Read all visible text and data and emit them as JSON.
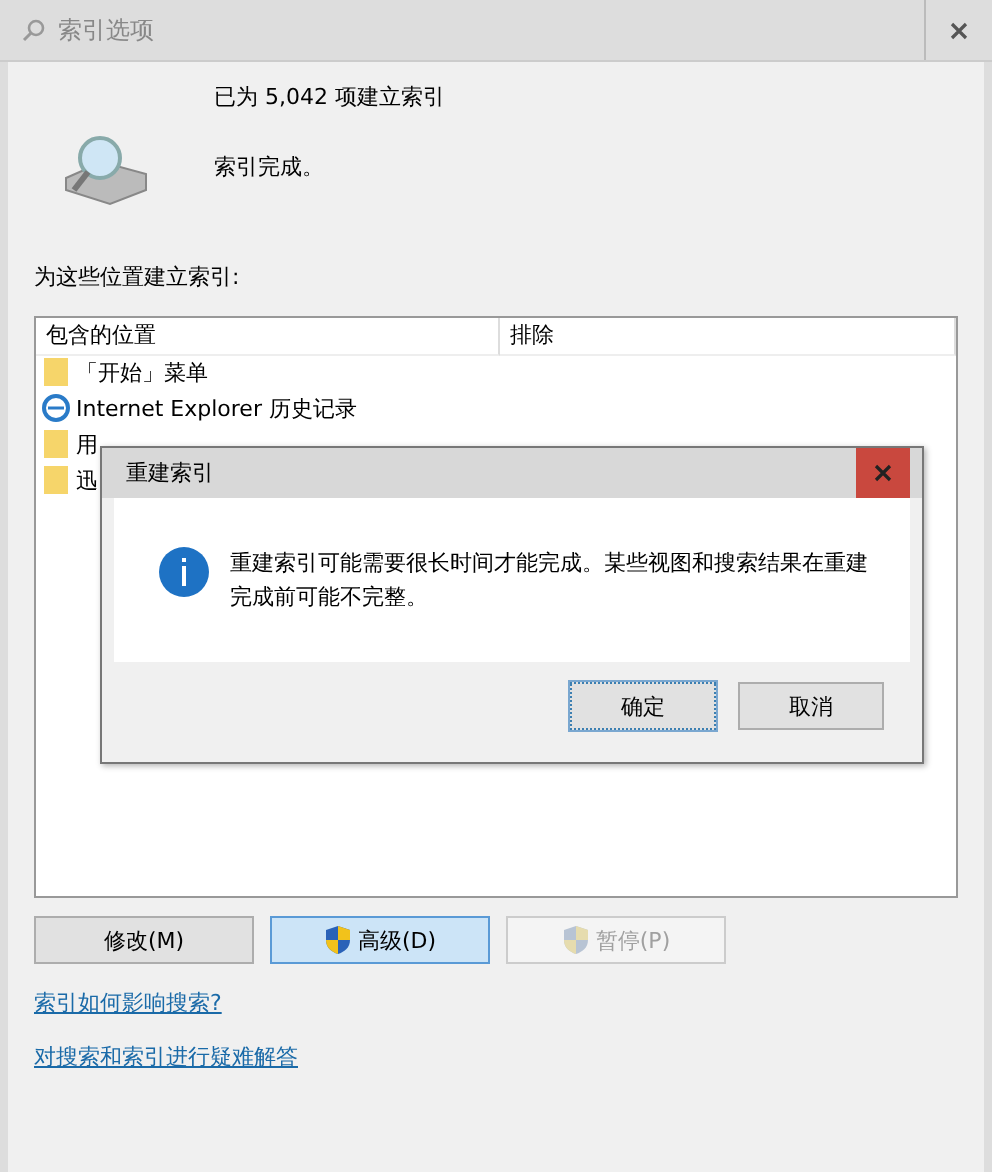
{
  "window": {
    "title": "索引选项"
  },
  "summary": {
    "count_text": "已为 5,042 项建立索引",
    "status": "索引完成。"
  },
  "locations_label": "为这些位置建立索引:",
  "table": {
    "columns": [
      "包含的位置",
      "排除"
    ],
    "rows": [
      {
        "kind": "folder",
        "location": "「开始」菜单"
      },
      {
        "kind": "browser",
        "location": "Internet Explorer 历史记录"
      },
      {
        "kind": "folder",
        "location": "用"
      },
      {
        "kind": "folder",
        "location": "迅"
      }
    ]
  },
  "buttons": [
    {
      "label": "修改(M)",
      "shield": false,
      "focused": false,
      "disabled": false
    },
    {
      "label": "高级(D)",
      "shield": true,
      "focused": true,
      "disabled": false
    },
    {
      "label": "暂停(P)",
      "shield": true,
      "focused": false,
      "disabled": true
    }
  ],
  "links": [
    "索引如何影响搜索?",
    "对搜索和索引进行疑难解答"
  ],
  "dialog": {
    "title": "重建索引",
    "message": "重建索引可能需要很长时间才能完成。某些视图和搜索结果在重建完成前可能不完整。",
    "buttons": [
      {
        "label": "确定",
        "focused": true
      },
      {
        "label": "取消",
        "focused": false
      }
    ]
  }
}
